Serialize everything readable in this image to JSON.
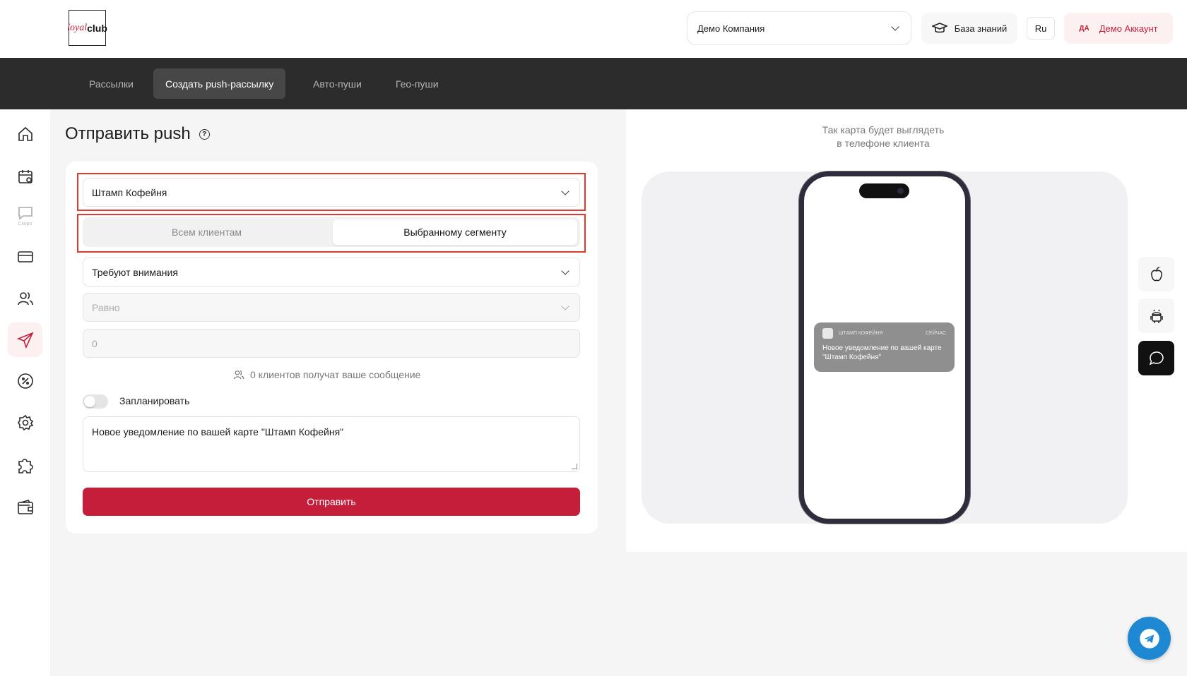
{
  "header": {
    "logo_part1": "loyal",
    "logo_part2": "club",
    "company_select": "Демо Компания",
    "knowledge_base": "База знаний",
    "language": "Ru",
    "account_initials": "ДА",
    "account_name": "Демо Аккаунт"
  },
  "tabs": [
    {
      "label": "Рассылки",
      "active": false
    },
    {
      "label": "Создать push-рассылку",
      "active": true
    },
    {
      "label": "Авто-пуши",
      "active": false
    },
    {
      "label": "Гео-пуши",
      "active": false
    }
  ],
  "sidebar": {
    "icons": [
      "home-icon",
      "calendar-icon",
      "chat-icon",
      "card-icon",
      "users-icon",
      "send-icon",
      "discount-icon",
      "gear-icon",
      "puzzle-icon",
      "wallet-icon"
    ],
    "soon_label": "Скоро",
    "active": "send-icon"
  },
  "page": {
    "title": "Отправить push",
    "card_select": "Штамп Кофейня",
    "audience_all": "Всем клиентам",
    "audience_segment": "Выбранному сегменту",
    "segment_select": "Требуют внимания",
    "condition_placeholder": "Равно",
    "value_placeholder": "0",
    "recipients_text": "0 клиентов получат ваше сообщение",
    "schedule_label": "Запланировать",
    "message": "Новое уведомление по вашей карте \"Штамп Кофейня\"",
    "send_label": "Отправить"
  },
  "preview": {
    "caption_line1": "Так карта будет выглядеть",
    "caption_line2": "в телефоне клиента",
    "notif_app": "ШТАМП КОФЕЙНЯ",
    "notif_time": "СЕЙЧАС",
    "notif_message": "Новое уведомление по вашей карте \"Штамп Кофейня\"",
    "os_buttons": [
      "apple-icon",
      "android-icon",
      "chat-bubble-icon"
    ],
    "active_os": "chat-bubble-icon"
  },
  "colors": {
    "brand": "#c41e3a",
    "tabbar": "#2c2c2c",
    "highlight": "#e03a2f",
    "telegram": "#1e88d3"
  }
}
